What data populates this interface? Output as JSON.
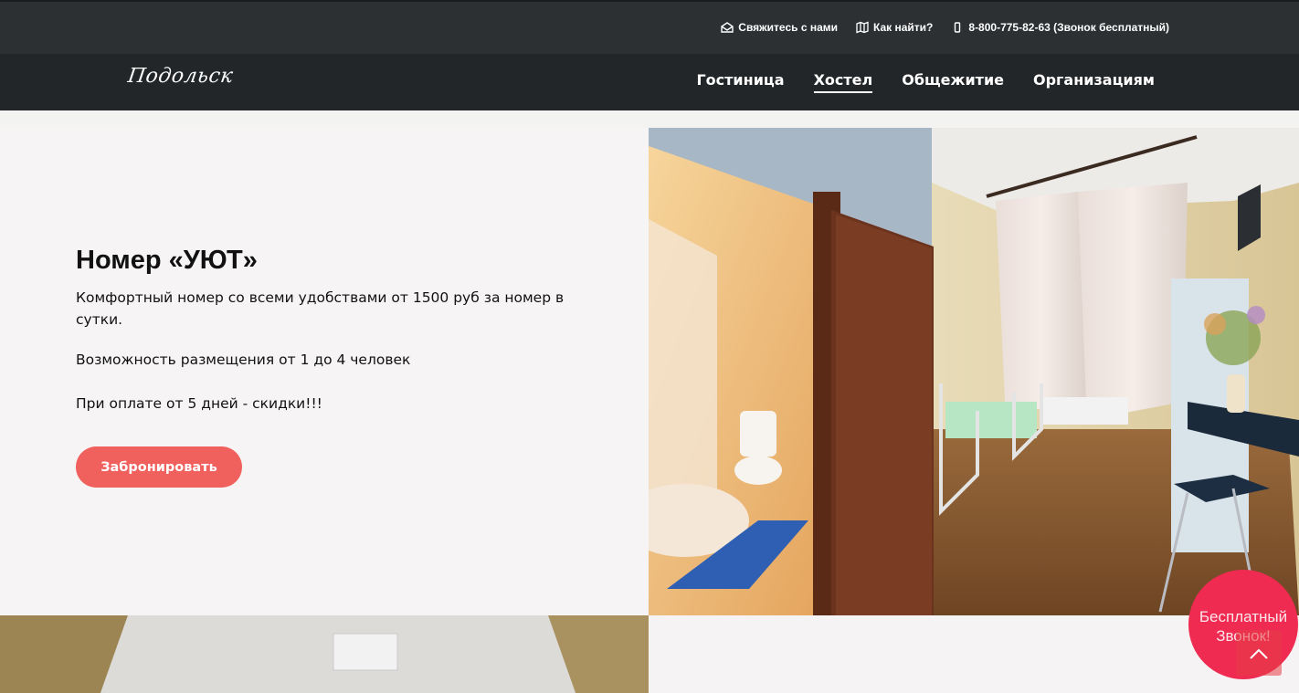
{
  "topbar": {
    "contact_us": "Свяжитесь с нами",
    "how_to_find": "Как найти?",
    "phone": "8-800-775-82-63 (Звонок бесплатный)"
  },
  "logo": "Подольск",
  "nav": {
    "items": [
      "Гостиница",
      "Хостел",
      "Общежитие",
      "Организациям"
    ],
    "active": "Хостел"
  },
  "room": {
    "title": "Номер «УЮТ»",
    "description": "Комфортный номер со всеми удобствами от 1500 руб за номер в сутки.",
    "capacity": "Возможность размещения от 1 до 4 человек",
    "discount": "При оплате от 5 дней - скидки!!!",
    "book_label": "Забронировать"
  },
  "callback": {
    "line1": "Бесплатный",
    "line2": "Звонок!"
  },
  "colors": {
    "accent": "#f0605d",
    "topbar": "#2c3033",
    "navbar": "#232628",
    "callback": "#ef2b52"
  }
}
